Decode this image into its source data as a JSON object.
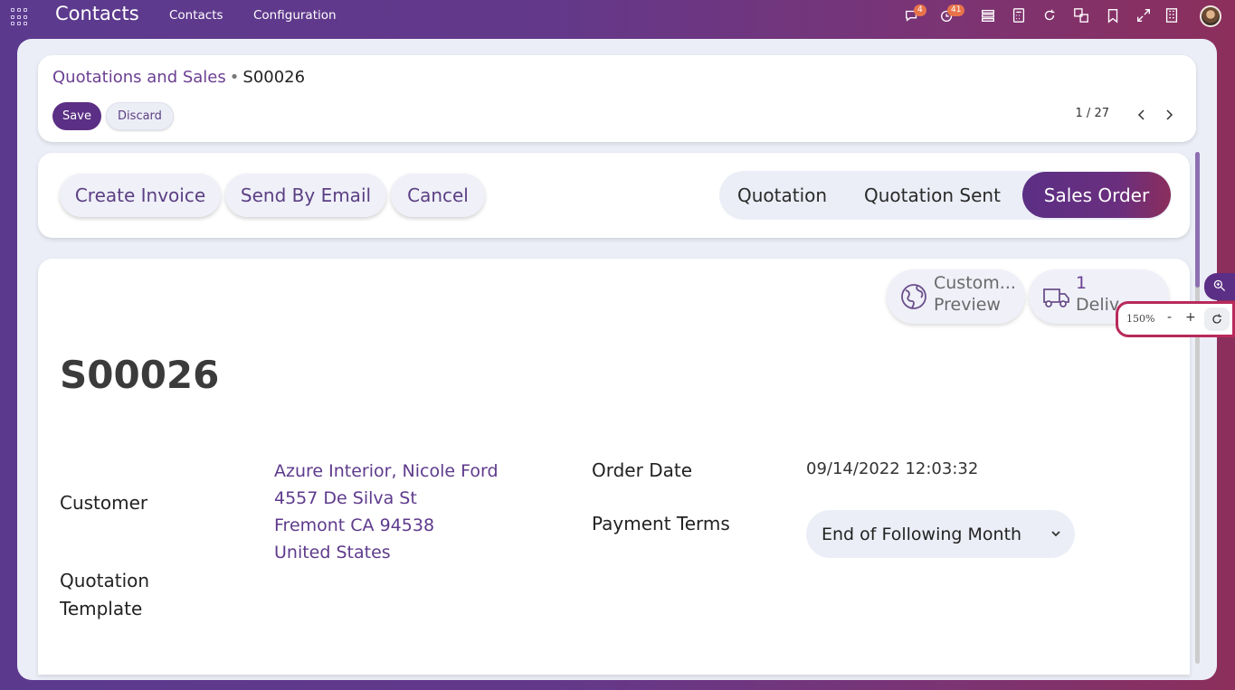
{
  "topbar": {
    "app_title": "Contacts",
    "nav": [
      "Contacts",
      "Configuration"
    ],
    "messages_badge": "4",
    "activities_badge": "41"
  },
  "breadcrumb": {
    "parent": "Quotations and Sales",
    "separator": "•",
    "current": "S00026"
  },
  "control": {
    "save": "Save",
    "discard": "Discard",
    "pager": "1 / 27"
  },
  "actions": [
    "Create Invoice",
    "Send By Email",
    "Cancel"
  ],
  "status": {
    "items": [
      "Quotation",
      "Quotation Sent",
      "Sales Order"
    ],
    "active": "Sales Order"
  },
  "smart_buttons": {
    "preview": {
      "line1": "Custom...",
      "line2": "Preview"
    },
    "delivery": {
      "line1": "1",
      "line2": "Deliv"
    }
  },
  "record": {
    "title": "S00026",
    "customer_label": "Customer",
    "customer_lines": [
      "Azure Interior, Nicole Ford",
      "4557 De Silva St",
      "Fremont CA 94538",
      "United States"
    ],
    "quotation_template_label_1": "Quotation",
    "quotation_template_label_2": "Template",
    "order_date_label": "Order Date",
    "order_date": "09/14/2022 12:03:32",
    "payment_terms_label": "Payment Terms",
    "payment_terms": "End of Following Month"
  },
  "zoom": {
    "level": "150%",
    "minus": "-",
    "plus": "+"
  },
  "colors": {
    "accent": "#5b2f85",
    "link": "#5e3a8c",
    "highlight_border": "#b82a5b"
  }
}
